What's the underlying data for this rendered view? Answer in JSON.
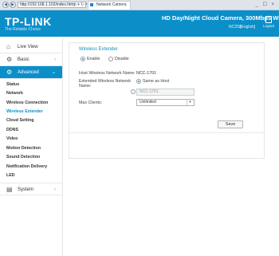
{
  "browser": {
    "back": "◀",
    "forward": "▶",
    "address": "http://192.168.1.102/index.html",
    "address_icons": "ρ ▾ ↻ ×",
    "tab_title": "Network Camera",
    "window_controls": "_ ☐ ×"
  },
  "header": {
    "logo": "TP-LINK",
    "tagline": "The Reliable Choice",
    "title": "HD Day/Night Cloud Camera, 300Mbps Wi-Fi",
    "model": "NC250",
    "language": "[English]",
    "logout": "Logout",
    "bg_color": "#0c8fc9"
  },
  "sidebar": {
    "live_view": "Live View",
    "basic": "Basic",
    "advanced": "Advanced",
    "system": "System",
    "icons": {
      "live_view": "home-icon",
      "basic": "gear-icon",
      "advanced": "gear-icon",
      "system": "clipboard-icon"
    },
    "submenu": [
      "Status",
      "Network",
      "Wireless Connection",
      "Wireless Extender",
      "Cloud Setting",
      "DDNS",
      "Video",
      "Motion Detection",
      "Sound Detection",
      "Notification Delivery",
      "LED"
    ],
    "selected": "Wireless Extender"
  },
  "form": {
    "section_title": "Wireless Extender",
    "enable_label": "Enable",
    "disable_label": "Disable",
    "enabled": true,
    "host_name_label": "Host Wireless Network Name:",
    "host_name_value": "NCC-1701",
    "extended_name_label_1": "Extended Wireless Network",
    "extended_name_label_2": "Name:",
    "same_as_host_label": "Same as Host",
    "same_as_host_selected": true,
    "extended_name_value": "NCC-1701",
    "max_clients_label": "Max Clients:",
    "max_clients_value": "Unlimited",
    "save_label": "Save"
  }
}
